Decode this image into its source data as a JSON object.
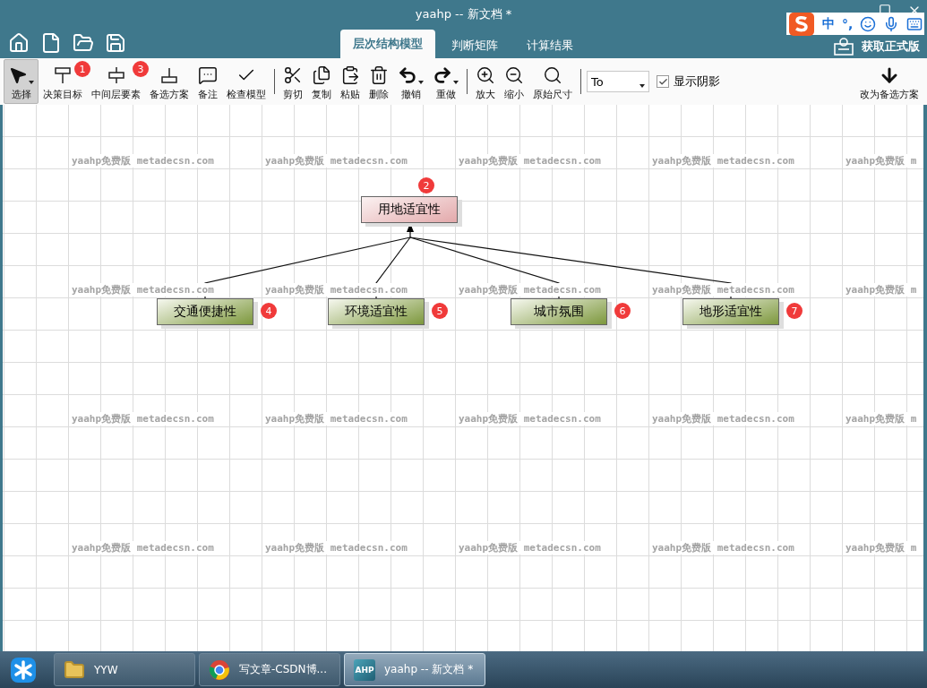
{
  "window": {
    "title": "yaahp -- 新文档 *"
  },
  "ime_bar": {
    "mode": "中",
    "punctuation": "°,"
  },
  "tabs": [
    {
      "label": "层次结构模型",
      "selected": true
    },
    {
      "label": "判断矩阵",
      "selected": false
    },
    {
      "label": "计算结果",
      "selected": false
    }
  ],
  "upgrade": {
    "label": "获取正式版"
  },
  "toolbar": {
    "groups": [
      [
        {
          "label": "选择",
          "pressed": true,
          "dropdown": true
        },
        {
          "label": "决策目标",
          "pressed": false,
          "dropdown": false,
          "badge": "1"
        },
        {
          "label": "中间层要素",
          "pressed": false,
          "dropdown": false,
          "badge": "3"
        },
        {
          "label": "备选方案",
          "pressed": false,
          "dropdown": false
        },
        {
          "label": "备注",
          "pressed": false,
          "dropdown": false
        },
        {
          "label": "检查模型",
          "pressed": false,
          "dropdown": false
        }
      ],
      [
        {
          "label": "剪切",
          "pressed": false,
          "dropdown": false
        },
        {
          "label": "复制",
          "pressed": false,
          "dropdown": false
        },
        {
          "label": "粘贴",
          "pressed": false,
          "dropdown": false
        },
        {
          "label": "删除",
          "pressed": false,
          "dropdown": false
        },
        {
          "label": "撤销",
          "pressed": false,
          "dropdown": true
        },
        {
          "label": "重做",
          "pressed": false,
          "dropdown": true
        }
      ],
      [
        {
          "label": "放大",
          "pressed": false,
          "dropdown": false
        },
        {
          "label": "缩小",
          "pressed": false,
          "dropdown": false
        },
        {
          "label": "原始尺寸",
          "pressed": false,
          "dropdown": false
        }
      ]
    ],
    "font_select": {
      "value": "To"
    },
    "shadow_checkbox": {
      "label": "显示阴影",
      "checked": true
    },
    "right_tool": {
      "label": "改为备选方案"
    }
  },
  "canvas": {
    "watermarks": [
      "yaahp免费版 metadecsn.com",
      "yaahp免费版 metadecsn.com",
      "yaahp免费版 metadecsn.com",
      "yaahp免费版 metadecsn.com",
      "yaahp免费版 m",
      "yaahp免费版 metadecsn.com",
      "yaahp免费版 metadecsn.com",
      "yaahp免费版 metadecsn.com",
      "yaahp免费版 metadecsn.com",
      "yaahp免费版 m",
      "yaahp免费版 metadecsn.com",
      "yaahp免费版 metadecsn.com",
      "yaahp免费版 metadecsn.com",
      "yaahp免费版 metadecsn.com",
      "yaahp免费版 m",
      "yaahp免费版 metadecsn.com",
      "yaahp免费版 metadecsn.com",
      "yaahp免费版 metadecsn.com",
      "yaahp免费版 metadecsn.com",
      "yaahp免费版 m"
    ],
    "root": {
      "label": "用地适宜性",
      "badge": "2"
    },
    "criteria": [
      {
        "label": "交通便捷性",
        "badge": "4"
      },
      {
        "label": "环境适宜性",
        "badge": "5"
      },
      {
        "label": "城市氛围",
        "badge": "6"
      },
      {
        "label": "地形适宜性",
        "badge": "7"
      }
    ]
  },
  "taskbar": {
    "tasks": [
      {
        "label": "YYW",
        "selected": false
      },
      {
        "label": "写文章-CSDN博...",
        "selected": false
      },
      {
        "label": "yaahp -- 新文档 *",
        "selected": true,
        "icon_label": "AHP"
      }
    ]
  }
}
